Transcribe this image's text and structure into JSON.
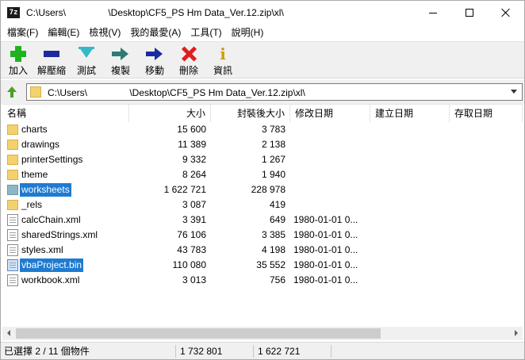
{
  "window": {
    "title": "C:\\Users\\                \\Desktop\\CF5_PS Hm Data_Ver.12.zip\\xl\\",
    "app_icon_label": "7z"
  },
  "menu": [
    "檔案(F)",
    "編輯(E)",
    "檢視(V)",
    "我的最愛(A)",
    "工具(T)",
    "說明(H)"
  ],
  "toolbar": {
    "add": "加入",
    "extract": "解壓縮",
    "test": "測試",
    "copy": "複製",
    "move": "移動",
    "delete": "刪除",
    "info": "資訊"
  },
  "address": {
    "path": "C:\\Users\\                \\Desktop\\CF5_PS Hm Data_Ver.12.zip\\xl\\"
  },
  "columns": {
    "name": "名稱",
    "size": "大小",
    "packed": "封裝後大小",
    "modified": "修改日期",
    "created": "建立日期",
    "accessed": "存取日期"
  },
  "files": [
    {
      "name": "charts",
      "type": "folder",
      "size": "15 600",
      "packed": "3 783",
      "modified": "",
      "selected": false
    },
    {
      "name": "drawings",
      "type": "folder",
      "size": "11 389",
      "packed": "2 138",
      "modified": "",
      "selected": false
    },
    {
      "name": "printerSettings",
      "type": "folder",
      "size": "9 332",
      "packed": "1 267",
      "modified": "",
      "selected": false
    },
    {
      "name": "theme",
      "type": "folder",
      "size": "8 264",
      "packed": "1 940",
      "modified": "",
      "selected": false
    },
    {
      "name": "worksheets",
      "type": "folder",
      "size": "1 622 721",
      "packed": "228 978",
      "modified": "",
      "selected": true
    },
    {
      "name": "_rels",
      "type": "folder",
      "size": "3 087",
      "packed": "419",
      "modified": "",
      "selected": false
    },
    {
      "name": "calcChain.xml",
      "type": "file",
      "size": "3 391",
      "packed": "649",
      "modified": "1980-01-01 0...",
      "selected": false
    },
    {
      "name": "sharedStrings.xml",
      "type": "file",
      "size": "76 106",
      "packed": "3 385",
      "modified": "1980-01-01 0...",
      "selected": false
    },
    {
      "name": "styles.xml",
      "type": "file",
      "size": "43 783",
      "packed": "4 198",
      "modified": "1980-01-01 0...",
      "selected": false
    },
    {
      "name": "vbaProject.bin",
      "type": "file",
      "size": "110 080",
      "packed": "35 552",
      "modified": "1980-01-01 0...",
      "selected": true
    },
    {
      "name": "workbook.xml",
      "type": "file",
      "size": "3 013",
      "packed": "756",
      "modified": "1980-01-01 0...",
      "selected": false
    }
  ],
  "status": {
    "selection": "已選擇 2 / 11 個物件",
    "total_size": "1 732 801",
    "selected_size": "1 622 721"
  }
}
